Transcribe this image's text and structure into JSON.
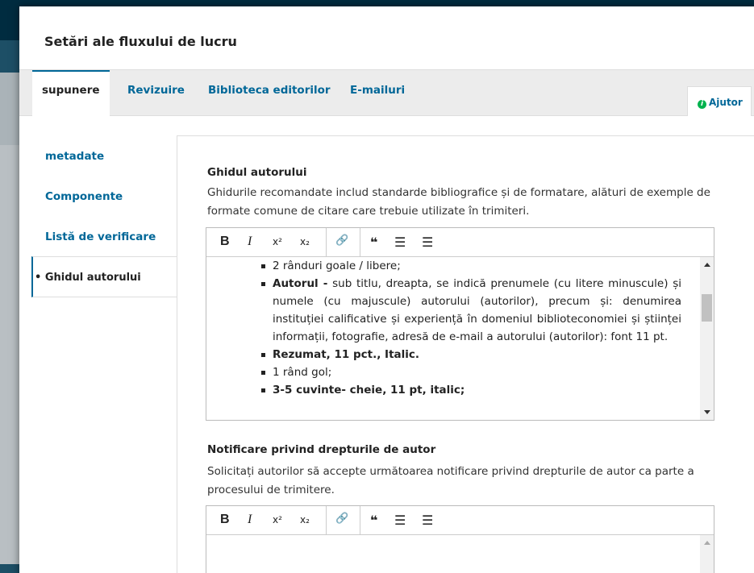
{
  "modal": {
    "title": "Setări ale fluxului de lucru"
  },
  "tabs": [
    {
      "label": "supunere"
    },
    {
      "label": "Revizuire"
    },
    {
      "label": "Biblioteca editorilor"
    },
    {
      "label": "E-mailuri"
    }
  ],
  "help": {
    "label": "Ajutor"
  },
  "sidenav": [
    {
      "label": "metadate"
    },
    {
      "label": "Componente"
    },
    {
      "label": "Listă de verificare"
    },
    {
      "label": "• Ghidul autorului"
    }
  ],
  "guidelines": {
    "title": "Ghidul autorului",
    "description": "Ghidurile recomandate includ standarde bibliografice și de formatare, alături de exemple de formate comune de citare care trebuie utilizate în trimiteri.",
    "items": {
      "i0": "2 rânduri goale / libere;",
      "i1_bold": "Autorul -",
      "i1_rest": "  sub titlu, dreapta, se indică prenumele (cu litere minuscule) și numele (cu majuscule) autorului (autorilor), precum și: denumirea instituției calificative și experiență în domeniul biblioteconomiei și științei informații, fotografie, adresă de e-mail a autorului (autorilor): font 11 pt.",
      "i2": "Rezumat, 11 pct., Italic.",
      "i3": "1 rând gol;",
      "i4": "3-5 cuvinte- cheie, 11 pt, italic;"
    }
  },
  "copyright": {
    "title": "Notificare privind drepturile de autor",
    "description": "Solicitați autorilor să accepte următoarea notificare privind drepturile de autor ca parte a procesului de trimitere."
  },
  "toolbar": {
    "bold": "B",
    "italic": "I",
    "superscript": "x²",
    "subscript": "x₂",
    "link": "🔗",
    "quote": "❝",
    "bullet_list": "☰",
    "numbered_list": "☰"
  }
}
